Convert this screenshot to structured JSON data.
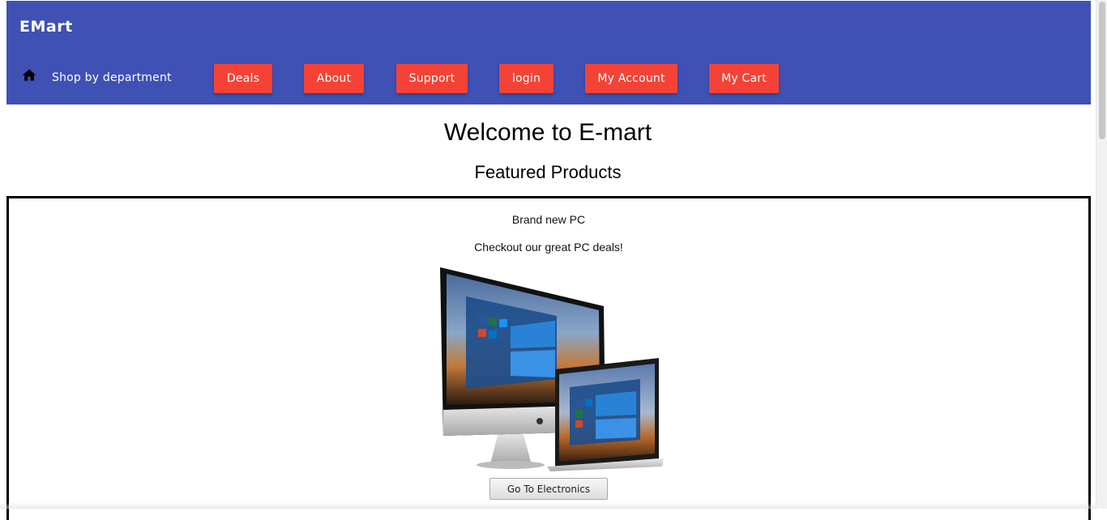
{
  "header": {
    "brand": "EMart",
    "home_icon": "home-icon",
    "department_link": "Shop by department",
    "nav": [
      {
        "label": "Deals"
      },
      {
        "label": "About"
      },
      {
        "label": "Support"
      },
      {
        "label": "login"
      },
      {
        "label": "My Account"
      },
      {
        "label": "My Cart"
      }
    ]
  },
  "main": {
    "title": "Welcome to E-mart",
    "subtitle": "Featured Products"
  },
  "featured": {
    "title": "Brand new PC",
    "description": "Checkout our great PC deals!",
    "button": "Go To Electronics"
  },
  "colors": {
    "app_bar": "#3f51b5",
    "nav_button": "#f44336"
  }
}
